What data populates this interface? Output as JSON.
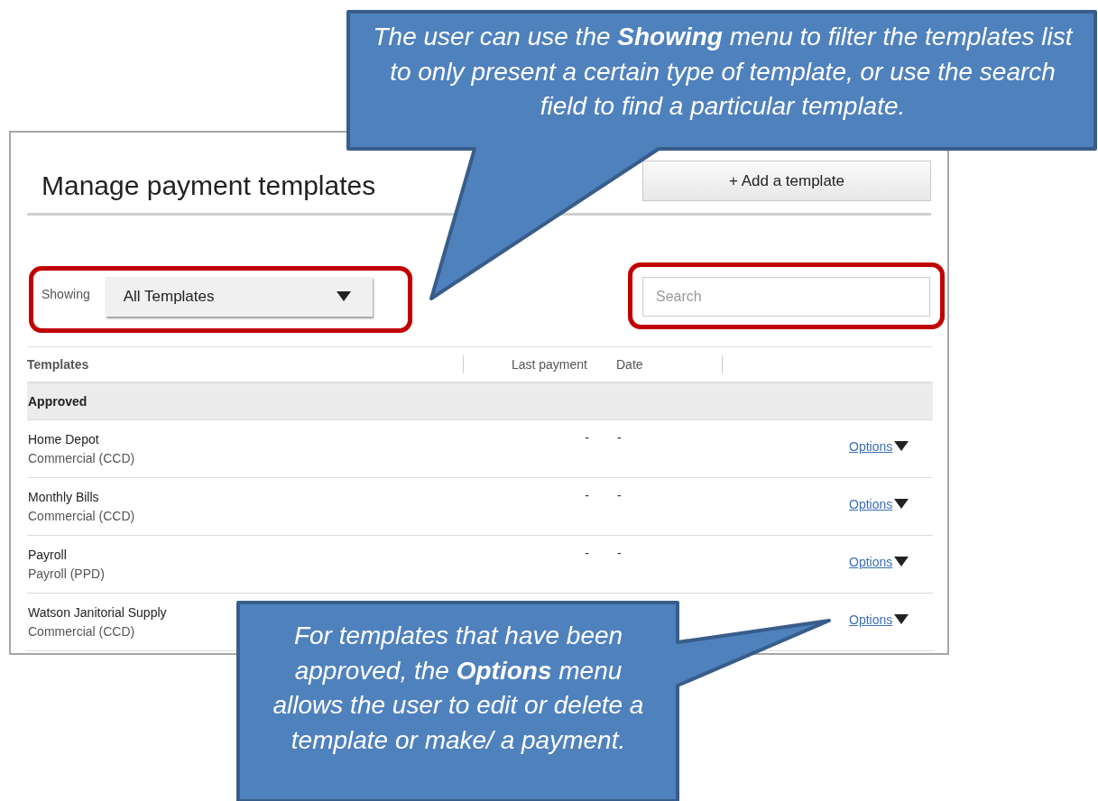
{
  "page": {
    "title": "Manage payment templates",
    "add_button": "+ Add a template"
  },
  "filter": {
    "label": "Showing",
    "value": "All Templates"
  },
  "search": {
    "placeholder": "Search"
  },
  "table": {
    "columns": [
      "Templates",
      "Last payment",
      "Date"
    ],
    "groups": [
      {
        "name": "Approved",
        "rows": [
          {
            "name": "Home Depot",
            "type": "Commercial (CCD)",
            "last_payment": "-",
            "date": "-",
            "action": "Options"
          },
          {
            "name": "Monthly Bills",
            "type": "Commercial (CCD)",
            "last_payment": "-",
            "date": "-",
            "action": "Options"
          },
          {
            "name": "Payroll",
            "type": "Payroll (PPD)",
            "last_payment": "-",
            "date": "-",
            "action": "Options"
          },
          {
            "name": "Watson Janitorial Supply",
            "type": "Commercial (CCD)",
            "action": "Options"
          }
        ]
      }
    ]
  },
  "callouts": [
    {
      "text": "The user can use the **Showing** menu to filter the templates list to only present a certain type of template, or use the search field to find a particular template."
    },
    {
      "text": "For templates that have been approved, the **Options** menu allows  the user to edit or delete a template or make/ a payment."
    }
  ]
}
